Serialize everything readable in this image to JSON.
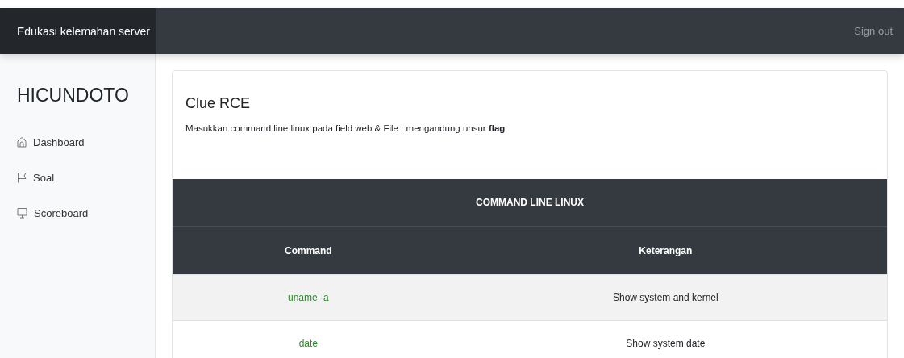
{
  "navbar": {
    "brand": "Edukasi kelemahan server",
    "sign_out": "Sign out"
  },
  "sidebar": {
    "title": "HICUNDOTO",
    "items": [
      {
        "label": "Dashboard"
      },
      {
        "label": "Soal"
      },
      {
        "label": "Scoreboard"
      }
    ]
  },
  "card": {
    "title": "Clue RCE",
    "text": "Masukkan command line linux pada field web & File : mengandung unsur **flag**"
  },
  "table": {
    "caption": "COMMAND LINE LINUX",
    "columns": [
      "Command",
      "Keterangan"
    ],
    "rows": [
      {
        "command": "uname -a",
        "description": "Show system and kernel"
      },
      {
        "command": "date",
        "description": "Show system date"
      }
    ]
  }
}
